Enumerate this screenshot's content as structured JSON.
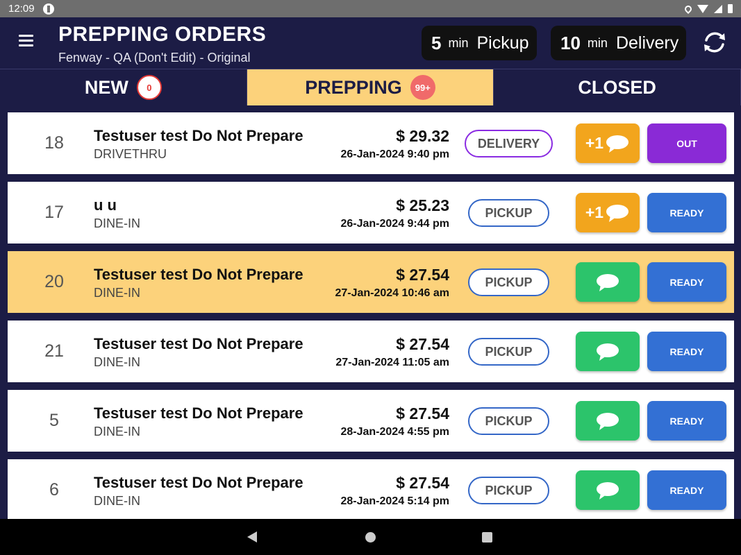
{
  "statusbar": {
    "time": "12:09"
  },
  "header": {
    "title": "PREPPING ORDERS",
    "subtitle": "Fenway - QA  (Don't Edit) - Original",
    "pickup": {
      "num": "5",
      "unit": "min",
      "label": "Pickup"
    },
    "delivery": {
      "num": "10",
      "unit": "min",
      "label": "Delivery"
    }
  },
  "tabs": [
    {
      "label": "NEW",
      "badge": "0"
    },
    {
      "label": "PREPPING",
      "badge": "99+"
    },
    {
      "label": "CLOSED"
    }
  ],
  "orders": [
    {
      "num": "18",
      "name": "Testuser test Do Not Prepare",
      "type": "DRIVETHRU",
      "price": "$  29.32",
      "date": "26-Jan-2024 9:40 pm",
      "chip": "DELIVERY",
      "msg_plus": "+1",
      "action": "OUT"
    },
    {
      "num": "17",
      "name": "u u",
      "type": "DINE-IN",
      "price": "$  25.23",
      "date": "26-Jan-2024 9:44 pm",
      "chip": "PICKUP",
      "msg_plus": "+1",
      "action": "READY"
    },
    {
      "num": "20",
      "name": "Testuser test Do Not Prepare",
      "type": "DINE-IN",
      "price": "$  27.54",
      "date": "27-Jan-2024 10:46 am",
      "chip": "PICKUP",
      "msg_plus": "",
      "action": "READY"
    },
    {
      "num": "21",
      "name": "Testuser test Do Not Prepare",
      "type": "DINE-IN",
      "price": "$  27.54",
      "date": "27-Jan-2024 11:05 am",
      "chip": "PICKUP",
      "msg_plus": "",
      "action": "READY"
    },
    {
      "num": "5",
      "name": "Testuser test Do Not Prepare",
      "type": "DINE-IN",
      "price": "$  27.54",
      "date": "28-Jan-2024 4:55 pm",
      "chip": "PICKUP",
      "msg_plus": "",
      "action": "READY"
    },
    {
      "num": "6",
      "name": "Testuser test Do Not Prepare",
      "type": "DINE-IN",
      "price": "$  27.54",
      "date": "28-Jan-2024 5:14 pm",
      "chip": "PICKUP",
      "msg_plus": "",
      "action": "READY"
    }
  ],
  "colors": {
    "navy": "#1c1c45",
    "highlight": "#fcd27b",
    "green": "#2cc46b",
    "orange": "#f2a51d",
    "blue": "#3370d4",
    "purple": "#8a2ad6"
  }
}
